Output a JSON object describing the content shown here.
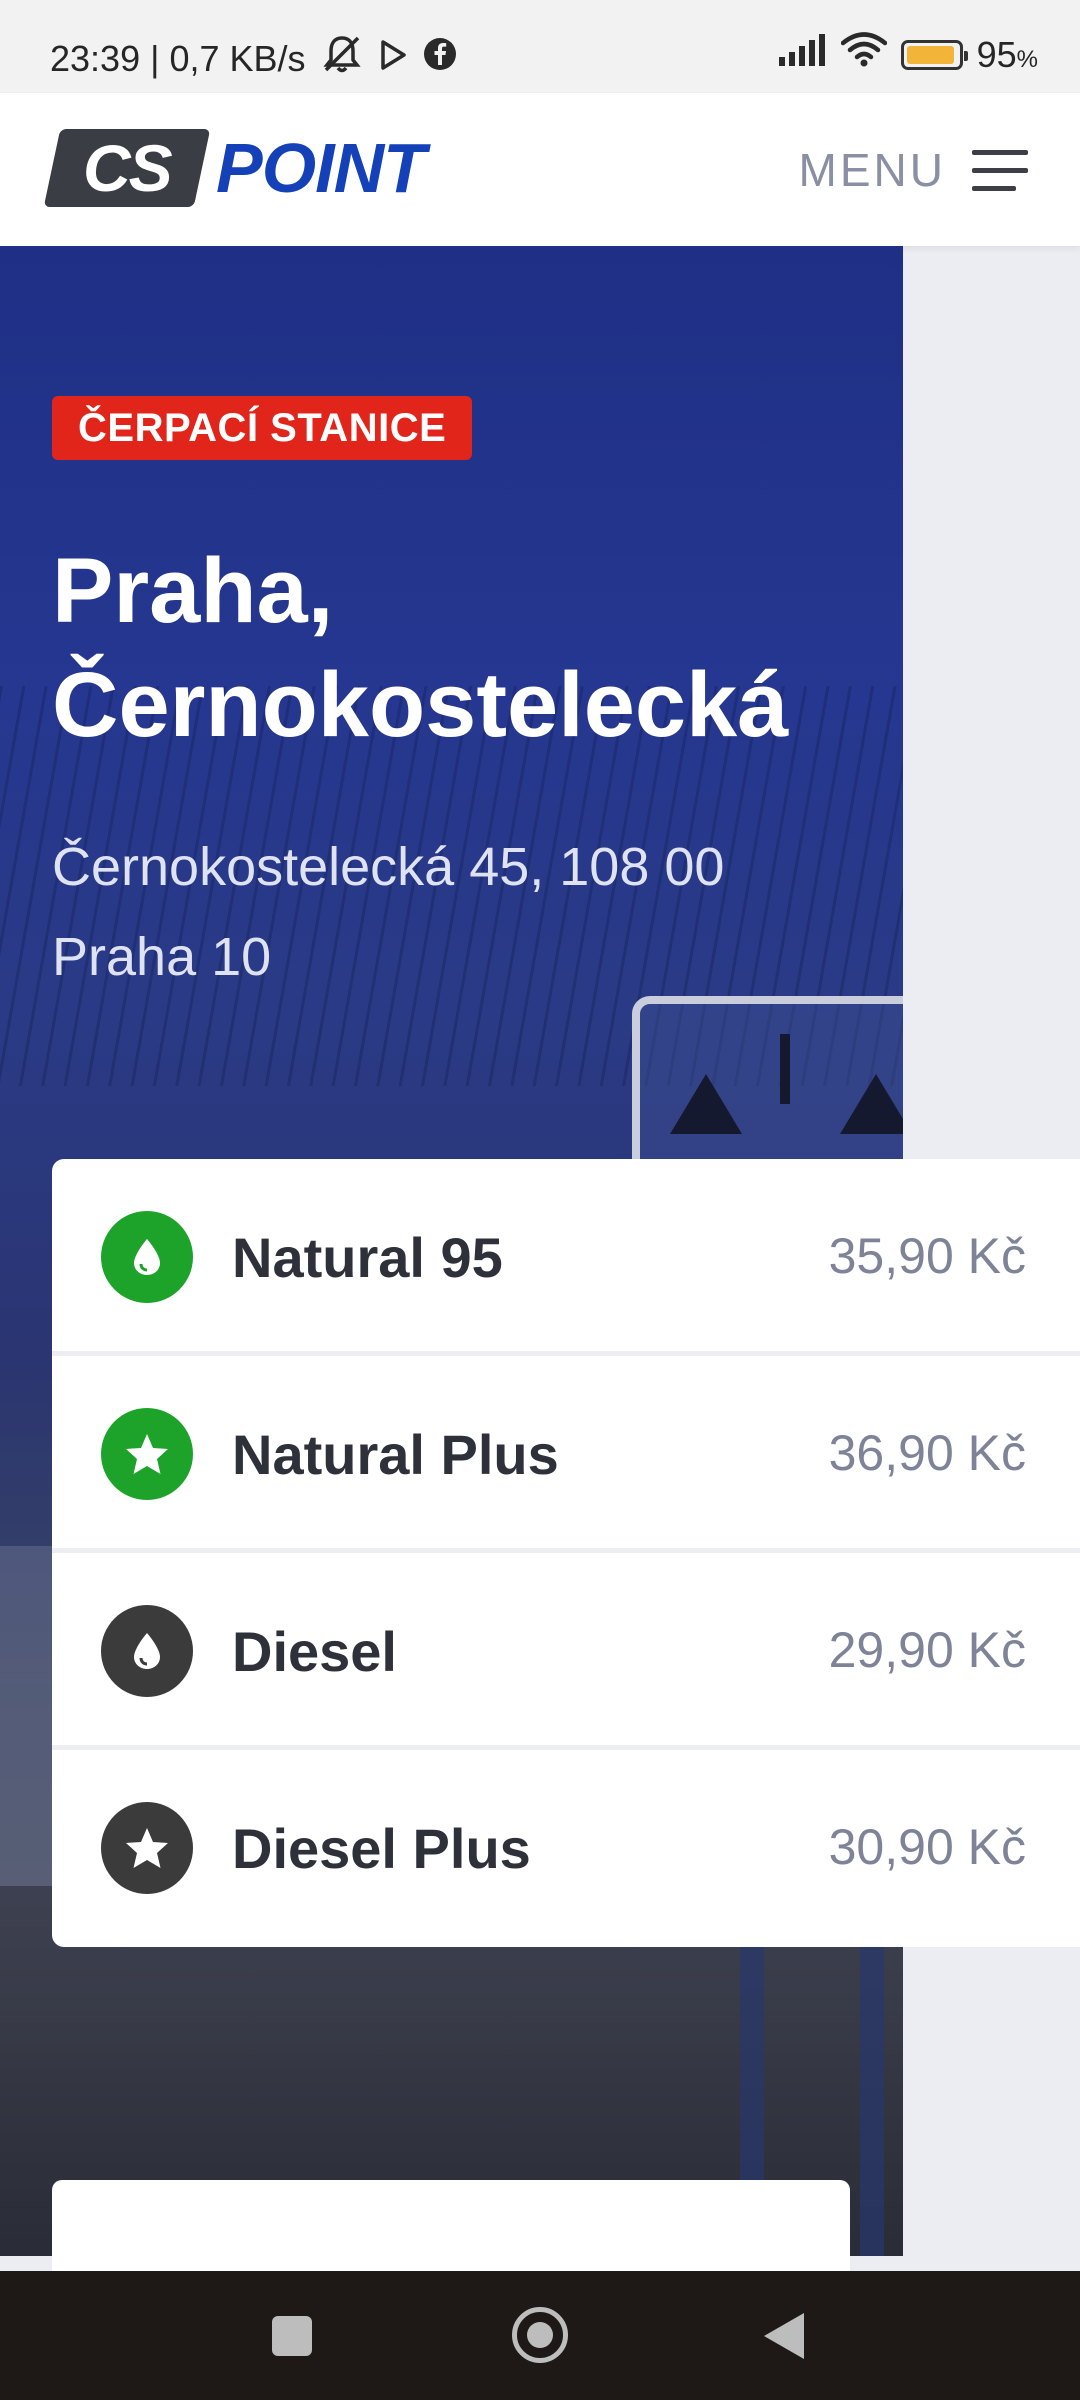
{
  "status_bar": {
    "time_speed": "23:39 | 0,7 KB/s",
    "battery": "95",
    "battery_unit": "%",
    "battery_level": 0.95
  },
  "header": {
    "logo_cs": "CS",
    "logo_point": "POINT",
    "menu_label": "MENU"
  },
  "station": {
    "badge": "ČERPACÍ STANICE",
    "title_line1": "Praha,",
    "title_line2": "Černokostelecká",
    "address_line1": "Černokostelecká 45, 108 00",
    "address_line2": "Praha 10"
  },
  "fuels": [
    {
      "name": "Natural 95",
      "price": "35,90 Kč",
      "icon": "drop-icon",
      "color": "#1da32a"
    },
    {
      "name": "Natural Plus",
      "price": "36,90 Kč",
      "icon": "star-icon",
      "color": "#1da32a"
    },
    {
      "name": "Diesel",
      "price": "29,90 Kč",
      "icon": "drop-icon",
      "color": "#3b3b3b"
    },
    {
      "name": "Diesel Plus",
      "price": "30,90 Kč",
      "icon": "star-icon",
      "color": "#3b3b3b"
    }
  ],
  "colors": {
    "brand_blue": "#1541b8",
    "badge_red": "#e1251b",
    "hero_blue": "#253790"
  }
}
